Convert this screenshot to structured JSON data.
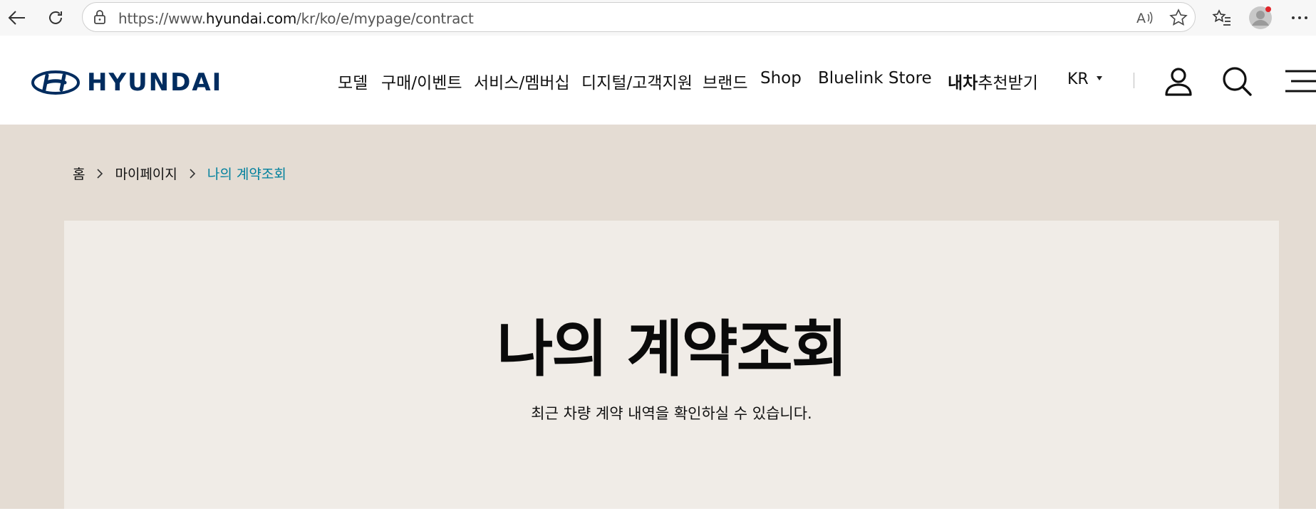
{
  "browser": {
    "url_prefix": "https://www.",
    "url_host": "hyundai.com",
    "url_path": "/kr/ko/e/mypage/contract"
  },
  "header": {
    "logo_text": "HYUNDAI",
    "nav": [
      {
        "label": "모델"
      },
      {
        "label": "구매/이벤트"
      },
      {
        "label": "서비스/멤버십"
      },
      {
        "label": "디지털/고객지원"
      },
      {
        "label": "브랜드"
      },
      {
        "label": "Shop"
      },
      {
        "label": "Bluelink Store"
      }
    ],
    "recommend_bold": "내차",
    "recommend_rest": "추천받기",
    "lang": "KR"
  },
  "breadcrumb": [
    "홈",
    "마이페이지",
    "나의 계약조회"
  ],
  "main": {
    "title": "나의 계약조회",
    "description": "최근 차량 계약 내역을 확인하실 수 있습니다."
  },
  "colors": {
    "brand_navy": "#002c5f",
    "accent_teal": "#00809d",
    "hero_bg": "#e4dcd3",
    "panel_bg": "#f0ece7"
  }
}
